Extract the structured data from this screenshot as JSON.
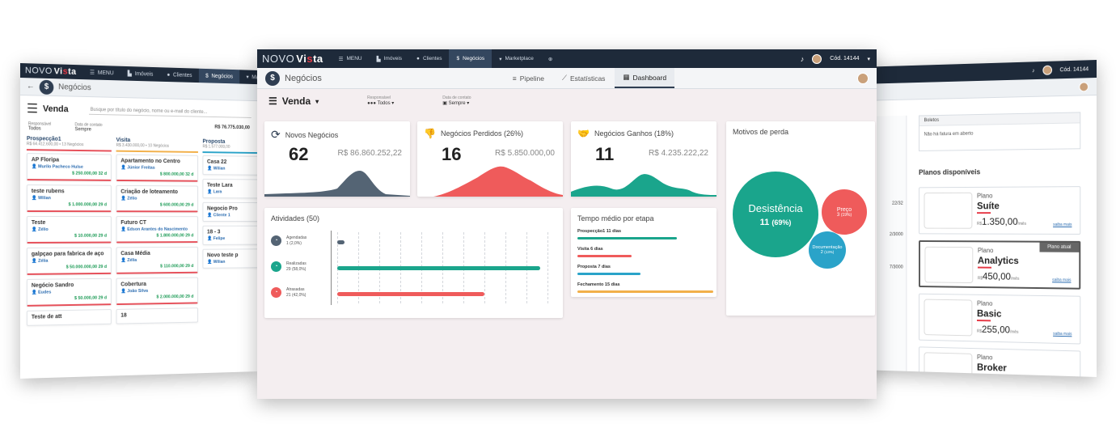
{
  "app": {
    "logo_novo": "NOVO",
    "logo_vista_a": "Vi",
    "logo_vista_b": "s",
    "logo_vista_c": "ta"
  },
  "nav": {
    "menu": "MENU",
    "imoveis": "Imóveis",
    "clientes": "Clientes",
    "negocios": "Negócios",
    "marketplace": "Marketplace",
    "user_code": "Cód. 14144"
  },
  "colors": {
    "navy": "#1e2a3a",
    "teal": "#1aa58c",
    "red": "#ef5b5b",
    "blue": "#2aa3c9",
    "slate": "#546474"
  },
  "left": {
    "section": "Negócios",
    "title": "Venda",
    "search_placeholder": "Busque por título do negócio, nome ou e-mail do cliente...",
    "responsavel_label": "Responsável",
    "responsavel_value": "Todos",
    "data_label": "Data de contato",
    "data_value": "Sempre",
    "total": "R$ 76.775.030,00",
    "columns": [
      {
        "name": "Prospecção1",
        "sub": "R$ 64.412.600,00 • 13 Negócios",
        "color": "#e6505a",
        "cards": [
          {
            "title": "AP Floripa",
            "name": "Murilo Pacheco Hulse",
            "value": "$ 250.000,00",
            "badge": "32 d"
          },
          {
            "title": "teste rubens",
            "name": "Wilian",
            "value": "$ 1.000.000,00",
            "badge": "29 d"
          },
          {
            "title": "Teste",
            "name": "Zélio",
            "value": "$ 10.000,00",
            "badge": "29 d"
          },
          {
            "title": "galpçao para fabrica de aço",
            "name": "Zélia",
            "value": "$ 50.000.000,00",
            "badge": "29 d"
          },
          {
            "title": "Negócio Sandro",
            "name": "Eudes",
            "value": "$ 50.000,00",
            "badge": "29 d"
          },
          {
            "title": "Teste de att",
            "name": "",
            "value": "",
            "badge": ""
          }
        ]
      },
      {
        "name": "Visita",
        "sub": "R$ 3.430.000,00 • 10 Negócios",
        "color": "#f2b04a",
        "cards": [
          {
            "title": "Apartamento no Centro",
            "name": "Júnior Freitas",
            "value": "$ 800.000,00",
            "badge": "32 d"
          },
          {
            "title": "Criação de loteamento",
            "name": "Zélio",
            "value": "$ 600.000,00",
            "badge": "29 d"
          },
          {
            "title": "Futuro CT",
            "name": "Edson Arantes do Nascimento",
            "value": "$ 1.800.000,00",
            "badge": "29 d"
          },
          {
            "title": "Casa Média",
            "name": "Zélia",
            "value": "$ 110.000,00",
            "badge": "29 d"
          },
          {
            "title": "Cobertura",
            "name": "João Silva",
            "value": "$ 2.000.000,00",
            "badge": "29 d"
          },
          {
            "title": "18",
            "name": "",
            "value": "",
            "badge": ""
          }
        ]
      },
      {
        "name": "Proposta",
        "sub": "R$ 1.577.000,00",
        "color": "#2aa3c9",
        "cards": [
          {
            "title": "Casa 22",
            "name": "Wilian",
            "value": "",
            "badge": ""
          },
          {
            "title": "Teste Lara",
            "name": "Lara",
            "value": "",
            "badge": ""
          },
          {
            "title": "Negocio Pro",
            "name": "Cliente 1",
            "value": "",
            "badge": ""
          },
          {
            "title": "18 - 3",
            "name": "Felipe",
            "value": "",
            "badge": ""
          },
          {
            "title": "Novo teste p",
            "name": "Wilian",
            "value": "",
            "badge": ""
          }
        ]
      }
    ]
  },
  "main": {
    "section": "Negócios",
    "tabs": [
      "Pipeline",
      "Estatísticas",
      "Dashboard"
    ],
    "title": "Venda",
    "responsavel_label": "Responsável",
    "responsavel_value": "Todos",
    "data_label": "Data de contato",
    "data_value": "Sempre",
    "kpis": [
      {
        "label": "Novos Negócios",
        "count": "62",
        "value": "R$ 86.860.252,22",
        "color": "#546474"
      },
      {
        "label": "Negócios Perdidos (26%)",
        "count": "16",
        "value": "R$ 5.850.000,00",
        "color": "#ef5b5b"
      },
      {
        "label": "Negócios Ganhos (18%)",
        "count": "11",
        "value": "R$ 4.235.222,22",
        "color": "#1aa58c"
      }
    ],
    "motivos": {
      "title": "Motivos de perda",
      "items": [
        {
          "name": "Desistência",
          "count": "11",
          "pct": "(69%)",
          "value": 11,
          "color": "#1aa58c"
        },
        {
          "name": "Preço",
          "count": "3",
          "pct": "(19%)",
          "value": 3,
          "color": "#ef5b5b"
        },
        {
          "name": "Documentação",
          "count": "2",
          "pct": "(13%)",
          "value": 2,
          "color": "#2aa3c9"
        }
      ]
    },
    "atividades": {
      "title": "Atividades (50)",
      "items": [
        {
          "name": "Agendadas",
          "stat": "1 (2,0%)",
          "value": 1,
          "color": "#546474"
        },
        {
          "name": "Realizadas",
          "stat": "29 (58,0%)",
          "value": 29,
          "color": "#1aa58c"
        },
        {
          "name": "Atrasadas",
          "stat": "21 (42,0%)",
          "value": 21,
          "color": "#ef5b5b"
        }
      ]
    },
    "tempo": {
      "title": "Tempo médio por etapa",
      "items": [
        {
          "label": "Prospecção1 11 dias",
          "days": 11,
          "color": "#1aa58c"
        },
        {
          "label": "Visita 6 dias",
          "days": 6,
          "color": "#ef5b5b"
        },
        {
          "label": "Proposta 7 dias",
          "days": 7,
          "color": "#2aa3c9"
        },
        {
          "label": "Fechamento 15 dias",
          "days": 15,
          "color": "#f2b04a"
        }
      ]
    }
  },
  "right": {
    "boletos_title": "Boletos",
    "boletos_text": "Não há fatura em aberto",
    "plans_title": "Planos disponíveis",
    "side_values": [
      "22/32",
      "2/3000",
      "7/3000"
    ],
    "plans": [
      {
        "label": "Plano",
        "name": "Suíte",
        "currency": "R$",
        "price": "1.350,00",
        "unit": "/mês",
        "more": "saiba mais",
        "current": false
      },
      {
        "label": "Plano",
        "name": "Analytics",
        "currency": "R$",
        "price": "450,00",
        "unit": "/mês",
        "more": "saiba mais",
        "current": true,
        "current_label": "Plano atual"
      },
      {
        "label": "Plano",
        "name": "Basic",
        "currency": "R$",
        "price": "255,00",
        "unit": "/mês",
        "more": "saiba mais",
        "current": false
      },
      {
        "label": "Plano",
        "name": "Broker",
        "currency": "",
        "price": "",
        "unit": "",
        "more": "",
        "current": false
      }
    ]
  }
}
